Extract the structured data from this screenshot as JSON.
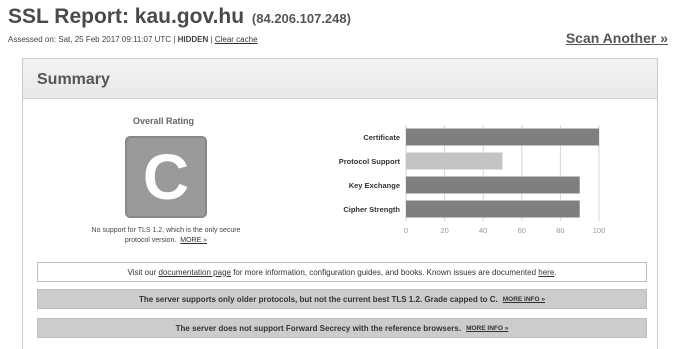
{
  "header": {
    "title": "SSL Report: kau.gov.hu",
    "ip": "(84.206.107.248)",
    "assessed_label": "Assessed on:",
    "assessed_date": "Sat, 25 Feb 2017 09:11:07 UTC",
    "separator1": "|",
    "hidden_label": "HIDDEN",
    "separator2": "|",
    "clear_cache": "Clear cache",
    "scan_another": "Scan Another »"
  },
  "summary": {
    "title": "Summary",
    "overall_rating_label": "Overall Rating",
    "grade": "C",
    "grade_color": "#9a9a9a",
    "grade_note": "No support for TLS 1.2, which is the only secure protocol version.",
    "grade_note_more": "MORE »"
  },
  "chart_data": {
    "type": "bar",
    "orientation": "horizontal",
    "categories": [
      "Certificate",
      "Protocol Support",
      "Key Exchange",
      "Cipher Strength"
    ],
    "values": [
      100,
      50,
      90,
      90
    ],
    "bar_colors": [
      "#7f7f7f",
      "#c4c4c4",
      "#7f7f7f",
      "#7f7f7f"
    ],
    "xlim": [
      0,
      100
    ],
    "xticks": [
      0,
      20,
      40,
      60,
      80,
      100
    ],
    "grid": true
  },
  "notices": {
    "docs": {
      "pre": "Visit our",
      "link": "documentation page",
      "mid": "for more information, configuration guides, and books. Known issues are documented",
      "link2": "here",
      "post": "."
    },
    "tls": {
      "text": "The server supports only older protocols, but not the current best TLS 1.2. Grade capped to C.",
      "more": "MORE INFO »"
    },
    "fs": {
      "text": "The server does not support Forward Secrecy with the reference browsers.",
      "more": "MORE INFO »"
    }
  }
}
